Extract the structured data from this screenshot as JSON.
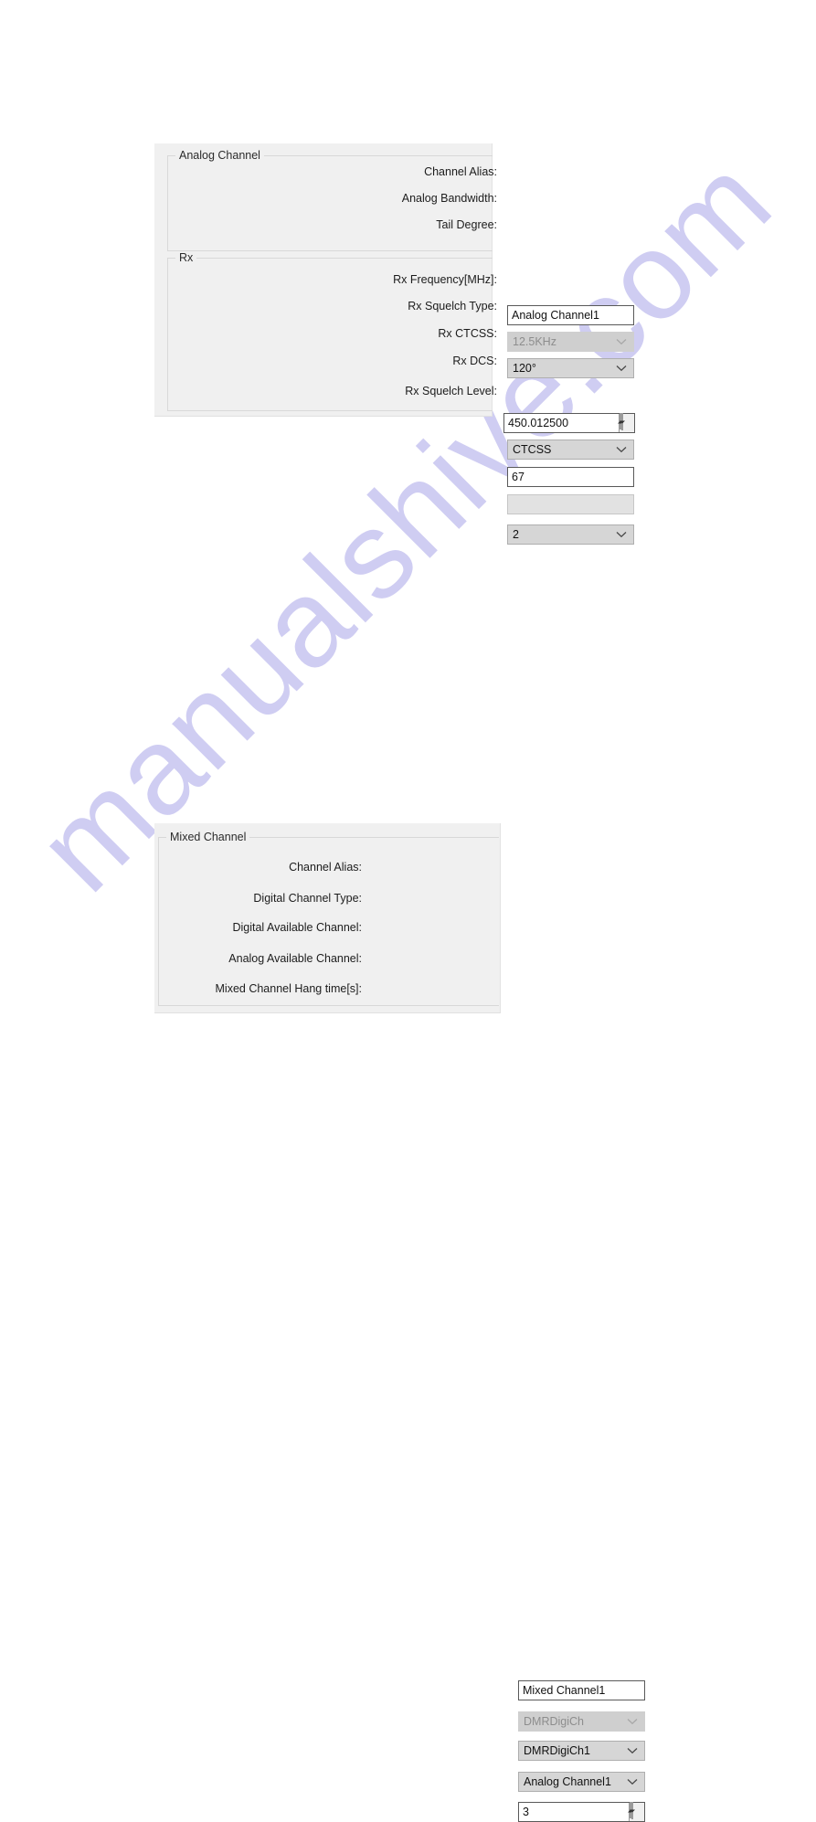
{
  "watermark": {
    "text": "manualshive.com",
    "color": "#cfcdf2"
  },
  "analog_channel_panel": {
    "group_title": "Analog Channel",
    "rows": [
      {
        "label": "Channel Alias:",
        "value": "Analog Channel1",
        "control": "text",
        "enabled": true
      },
      {
        "label": "Analog Bandwidth:",
        "value": "12.5KHz",
        "control": "combo",
        "enabled": false
      },
      {
        "label": "Tail Degree:",
        "value": "120°",
        "control": "combo",
        "enabled": true
      }
    ]
  },
  "rx_panel": {
    "group_title": "Rx",
    "rows": [
      {
        "label": "Rx Frequency[MHz]:",
        "value": "450.012500",
        "control": "spinner",
        "enabled": true
      },
      {
        "label": "Rx Squelch Type:",
        "value": "CTCSS",
        "control": "combo",
        "enabled": true
      },
      {
        "label": "Rx CTCSS:",
        "value": "67",
        "control": "text",
        "enabled": true
      },
      {
        "label": "Rx DCS:",
        "value": "",
        "control": "text",
        "enabled": false
      },
      {
        "label": "Rx Squelch Level:",
        "value": "2",
        "control": "combo",
        "enabled": true
      }
    ]
  },
  "mixed_channel_panel": {
    "group_title": "Mixed Channel",
    "rows": [
      {
        "label": "Channel Alias:",
        "value": "Mixed Channel1",
        "control": "text",
        "enabled": true
      },
      {
        "label": "Digital Channel Type:",
        "value": "DMRDigiCh",
        "control": "combo",
        "enabled": false
      },
      {
        "label": "Digital Available Channel:",
        "value": "DMRDigiCh1",
        "control": "combo",
        "enabled": true
      },
      {
        "label": "Analog Available Channel:",
        "value": "Analog Channel1",
        "control": "combo",
        "enabled": true
      },
      {
        "label": "Mixed Channel Hang time[s]:",
        "value": "3",
        "control": "spinner",
        "enabled": true
      }
    ]
  }
}
